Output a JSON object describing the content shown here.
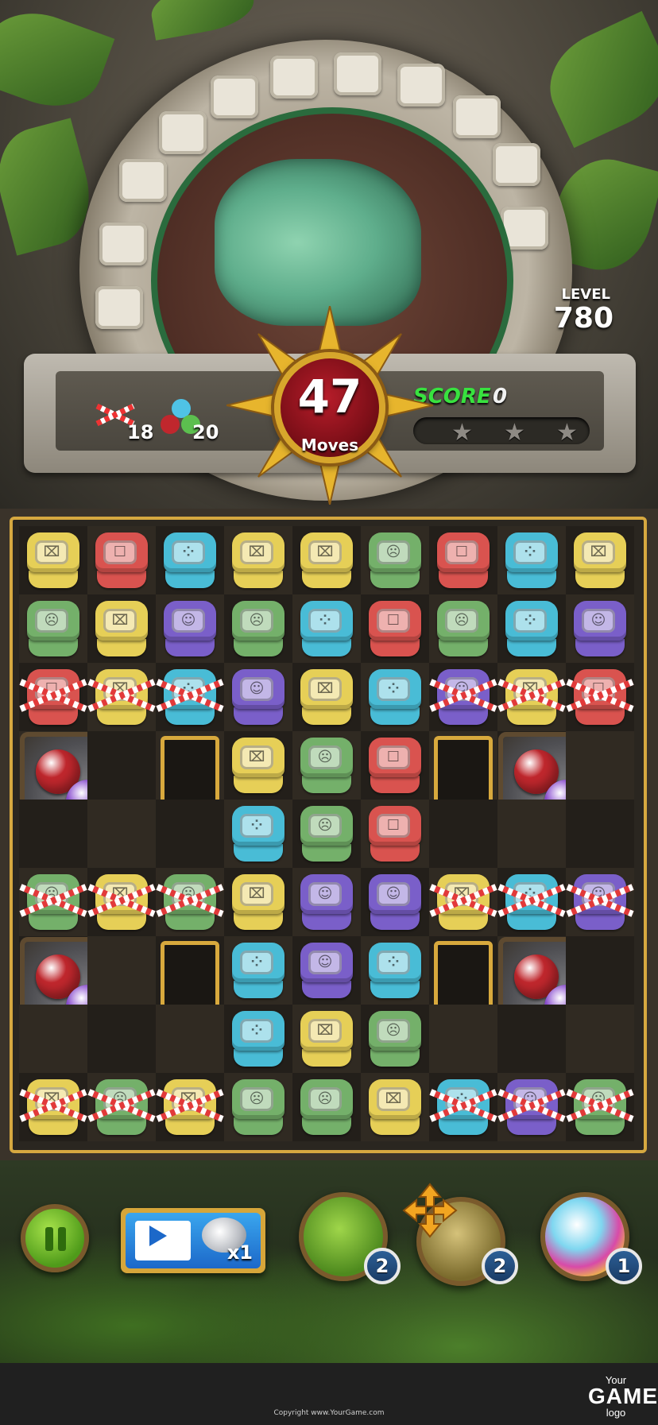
{
  "hud": {
    "level_label": "LEVEL",
    "level_value": "780",
    "moves_value": "47",
    "moves_label": "Moves",
    "score_label": "SCORE",
    "score_value": "0",
    "score_progress": 0,
    "stars_total": 3,
    "stars_earned": 0
  },
  "goals": [
    {
      "icon": "rope-icon",
      "count": "18"
    },
    {
      "icon": "orb-cluster-icon",
      "count": "20"
    }
  ],
  "board": {
    "columns": 9,
    "rows": 9,
    "legend": {
      "Y": "yellow",
      "R": "red",
      "B": "blue",
      "G": "green",
      "P": "purple"
    },
    "grid": [
      [
        "Y",
        "R",
        "B",
        "Y",
        "Y",
        "G",
        "R",
        "B",
        "Y"
      ],
      [
        "G",
        "Y",
        "P",
        "G",
        "B",
        "R",
        "G",
        "B",
        "P"
      ],
      [
        "R",
        "Y",
        "B",
        "P",
        "Y",
        "B",
        "P",
        "Y",
        "R"
      ],
      [
        "gem",
        "gem",
        "hole",
        "Y",
        "G",
        "R",
        "hole",
        "gem",
        "gem"
      ],
      [
        "gem",
        "gem",
        "hole",
        "B",
        "G",
        "R",
        "hole",
        "gem",
        "gem"
      ],
      [
        "G",
        "Y",
        "G",
        "Y",
        "P",
        "P",
        "Y",
        "B",
        "P"
      ],
      [
        "gem",
        "gem",
        "hole",
        "B",
        "P",
        "B",
        "hole",
        "gem",
        "gem"
      ],
      [
        "gem",
        "gem",
        "hole",
        "B",
        "Y",
        "G",
        "hole",
        "gem",
        "gem"
      ],
      [
        "Y",
        "G",
        "Y",
        "G",
        "G",
        "Y",
        "B",
        "P",
        "G"
      ]
    ],
    "roped_cells": [
      [
        2,
        0
      ],
      [
        2,
        1
      ],
      [
        2,
        2
      ],
      [
        2,
        6
      ],
      [
        2,
        7
      ],
      [
        2,
        8
      ],
      [
        5,
        0
      ],
      [
        5,
        1
      ],
      [
        5,
        2
      ],
      [
        5,
        6
      ],
      [
        5,
        7
      ],
      [
        5,
        8
      ],
      [
        8,
        0
      ],
      [
        8,
        1
      ],
      [
        8,
        2
      ],
      [
        8,
        6
      ],
      [
        8,
        7
      ],
      [
        8,
        8
      ]
    ]
  },
  "controls": {
    "video_reward_count": "x1",
    "boosters": [
      {
        "name": "hammer-booster",
        "count": "2"
      },
      {
        "name": "swap-booster",
        "count": "2"
      },
      {
        "name": "color-orb-booster",
        "count": "1"
      }
    ]
  },
  "footer": {
    "copyright": "Copyright www.YourGame.com",
    "brand_small": "Your",
    "brand_big": "GAME",
    "brand_sub": "logo"
  },
  "colors": {
    "yellow": "#e6cf57",
    "red": "#d9534f",
    "blue": "#49bcd6",
    "green": "#74b06a",
    "purple": "#7a5fc9",
    "frame_gold": "#d6a840",
    "score_green": "#38e23f"
  }
}
